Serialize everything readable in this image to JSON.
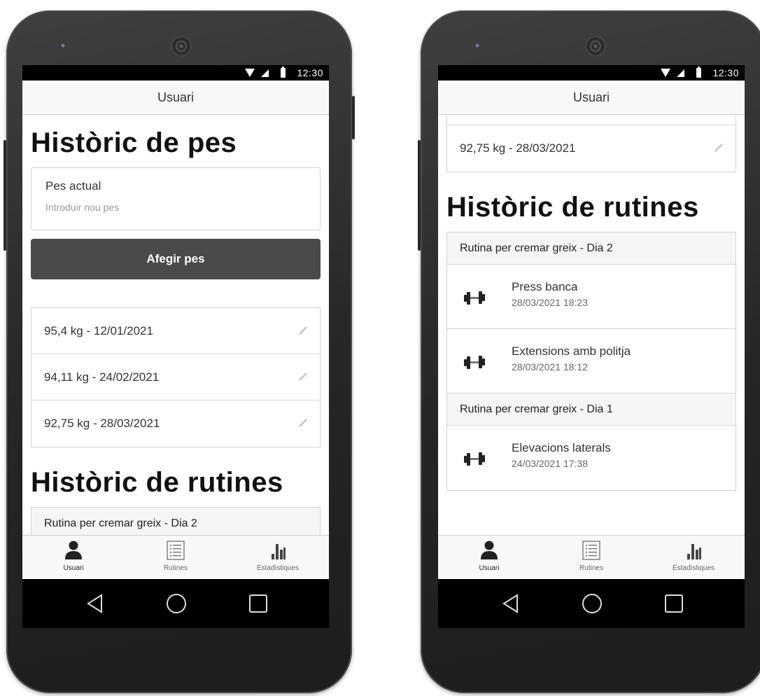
{
  "status": {
    "time": "12:30"
  },
  "header": {
    "title": "Usuari"
  },
  "weight": {
    "title": "Històric de pes",
    "input_label": "Pes actual",
    "input_placeholder": "Introduir nou pes",
    "add_button": "Afegir pes",
    "entries": [
      {
        "text": "95,4 kg - 12/01/2021"
      },
      {
        "text": "94,11 kg - 24/02/2021"
      },
      {
        "text": "92,75 kg - 28/03/2021"
      }
    ]
  },
  "routines": {
    "title": "Històric de rutines",
    "groups": [
      {
        "name": "Rutina per cremar greix - Dia 2",
        "exercises": [
          {
            "name": "Press banca",
            "datetime": "28/03/2021 18:23"
          },
          {
            "name": "Extensions amb politja",
            "datetime": "28/03/2021 18:12"
          }
        ]
      },
      {
        "name": "Rutina per cremar greix - Dia 1",
        "exercises": [
          {
            "name": "Elevacions laterals",
            "datetime": "24/03/2021 17:38"
          }
        ]
      }
    ]
  },
  "nav": {
    "items": [
      {
        "label": "Usuari",
        "icon": "user-icon",
        "active": true
      },
      {
        "label": "Rutines",
        "icon": "list-icon",
        "active": false
      },
      {
        "label": "Estadístiques",
        "icon": "bar-chart-icon",
        "active": false
      }
    ]
  },
  "system_nav": {
    "icons": [
      "back-icon",
      "home-icon",
      "recents-icon"
    ]
  },
  "colors": {
    "primary_button": "#4a4a4a",
    "header_bg": "#f8f8f8",
    "border": "#d4d4d4"
  }
}
